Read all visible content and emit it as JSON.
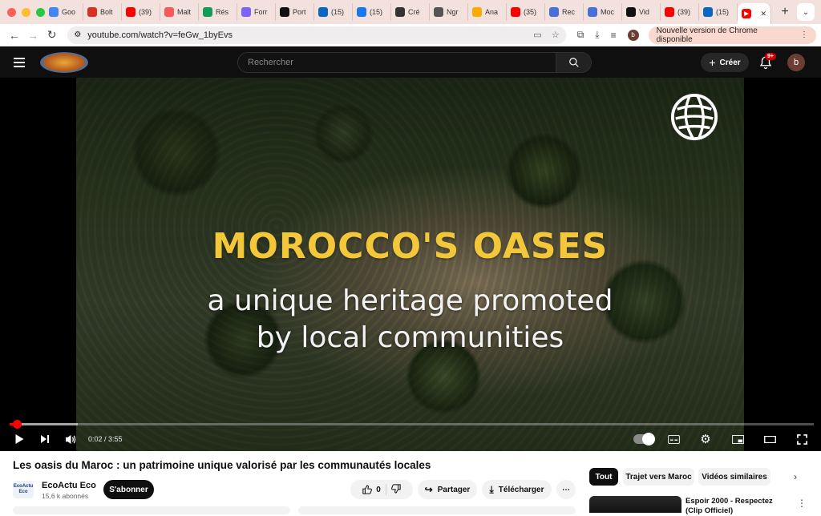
{
  "browser": {
    "tabs": [
      {
        "label": "Goo",
        "icon": "google-icon",
        "color": "#4285f4"
      },
      {
        "label": "Bolt",
        "icon": "gmail-icon",
        "color": "#d93025"
      },
      {
        "label": "(39)",
        "icon": "youtube-icon",
        "color": "#ff0000"
      },
      {
        "label": "Malt",
        "icon": "malt-icon",
        "color": "#fc5757"
      },
      {
        "label": "Rés",
        "icon": "sheets-icon",
        "color": "#0f9d58"
      },
      {
        "label": "Forr",
        "icon": "form-icon",
        "color": "#7b61ff"
      },
      {
        "label": "Port",
        "icon": "notion-icon",
        "color": "#111111"
      },
      {
        "label": "(15)",
        "icon": "linkedin-icon",
        "color": "#0a66c2"
      },
      {
        "label": "(15)",
        "icon": "facebook-icon",
        "color": "#1877f2"
      },
      {
        "label": "Cré",
        "icon": "openai-icon",
        "color": "#333333"
      },
      {
        "label": "Ngr",
        "icon": "ngrok-icon",
        "color": "#555555"
      },
      {
        "label": "Ana",
        "icon": "analytics-icon",
        "color": "#f9ab00"
      },
      {
        "label": "(35)",
        "icon": "youtube-icon",
        "color": "#ff0000"
      },
      {
        "label": "Rec",
        "icon": "chrome-icon",
        "color": "#4a6fd8"
      },
      {
        "label": "Moc",
        "icon": "chrome-icon",
        "color": "#4a6fd8"
      },
      {
        "label": "Vid",
        "icon": "pika-icon",
        "color": "#111111"
      },
      {
        "label": "(39)",
        "icon": "youtube-icon",
        "color": "#ff0000"
      },
      {
        "label": "(15)",
        "icon": "linkedin-icon",
        "color": "#0a66c2"
      }
    ],
    "active_tab_close": "✕",
    "new_tab": "+",
    "url": "youtube.com/watch?v=feGw_1byEvs",
    "profile_initial": "b",
    "update_label": "Nouvelle version de Chrome disponible"
  },
  "youtube": {
    "search_placeholder": "Rechercher",
    "create_label": "Créer",
    "notification_badge": "9+",
    "avatar_initial": "b"
  },
  "video": {
    "overlay_title": "MOROCCO'S OASES",
    "overlay_line1": "a unique heritage promoted",
    "overlay_line2": "by local communities",
    "current_time": "0:02",
    "duration": "3:55",
    "time_display": "0:02 / 3:55",
    "progress_fraction": 0.0085,
    "buffered_fraction": 0.085
  },
  "details": {
    "title": "Les oasis du Maroc : un patrimoine unique valorisé par les communautés locales",
    "channel_logo_text": "EcoActu Eco",
    "channel_name": "EcoActu Eco",
    "subscribers": "15,6 k abonnés",
    "subscribe_label": "S'abonner",
    "like_count": "0",
    "share_label": "Partager",
    "download_label": "Télécharger"
  },
  "sidebar": {
    "chips": [
      "Tout",
      "Trajet vers Maroc",
      "Vidéos similaires"
    ],
    "recommendation_title": "Espoir 2000 - Respectez (Clip Officiel)"
  },
  "colors": {
    "accent": "#ff0000",
    "overlay_yellow": "#f3c73a",
    "tabstrip": "#f2e1dc"
  }
}
